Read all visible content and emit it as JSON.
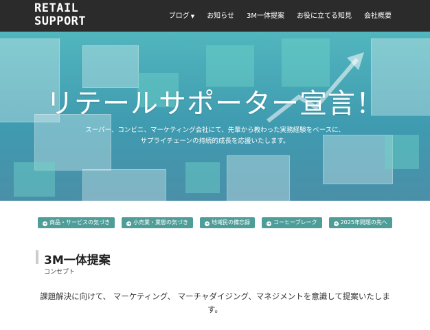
{
  "header": {
    "logo_line1": "RETAIL",
    "logo_line2": "SUPPORT",
    "nav": [
      "ブログ",
      "お知らせ",
      "3M一体提案",
      "お役に立てる知見",
      "会社概要"
    ]
  },
  "hero": {
    "title": "リテールサポーター宣言！",
    "subtitle_line1": "スーパー、コンビニ、マーケティング会社にて、先輩から教わった実務経験をベースに、",
    "subtitle_line2": "サプライチェーンの持続的成長を応援いたします。"
  },
  "category_buttons": [
    "商品・サービスの気づき",
    "小売業・業態の気づき",
    "地域民の備忘録",
    "コーヒーブレーク",
    "2025年問題の先へ"
  ],
  "section": {
    "title": "3M一体提案",
    "subtitle": "コンセプト",
    "body": "課題解決に向けて、 マーケティング、 マーチャダイジング、マネジメントを意識して提案いたします。"
  },
  "colors": {
    "header_bg": "#2b2b2b",
    "button_bg": "#4f9d98",
    "hero_base": "#4aa9b5"
  },
  "icons": {
    "nav_dropdown": "caret-down-icon",
    "button": "circle-arrow-icon"
  }
}
